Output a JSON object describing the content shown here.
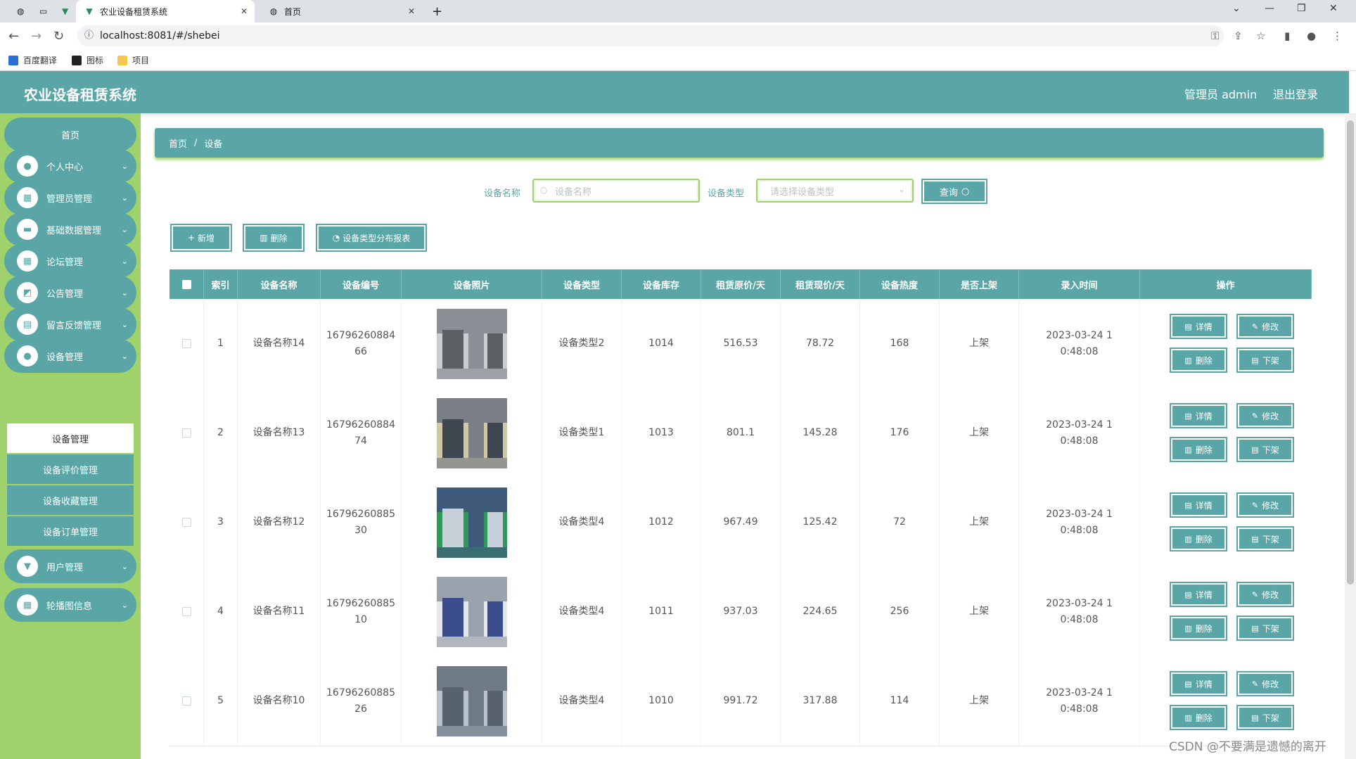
{
  "browser": {
    "tabs": [
      {
        "title": "农业设备租赁系统",
        "active": true
      },
      {
        "title": "首页",
        "active": false
      }
    ],
    "url": "localhost:8081/#/shebei",
    "bookmarks": [
      "百度翻译",
      "图标",
      "项目"
    ]
  },
  "header": {
    "title": "农业设备租赁系统",
    "user": "管理员 admin",
    "logout": "退出登录"
  },
  "sidebar": {
    "home": "首页",
    "items": [
      {
        "label": "个人中心",
        "icon": "user-icon"
      },
      {
        "label": "管理员管理",
        "icon": "grid-icon"
      },
      {
        "label": "基础数据管理",
        "icon": "monitor-icon"
      },
      {
        "label": "论坛管理",
        "icon": "grid-icon"
      },
      {
        "label": "公告管理",
        "icon": "chart-icon"
      },
      {
        "label": "留言反馈管理",
        "icon": "briefcase-icon"
      },
      {
        "label": "设备管理",
        "icon": "user-icon"
      }
    ],
    "submenu": [
      {
        "label": "设备管理",
        "active": true
      },
      {
        "label": "设备评价管理",
        "active": false
      },
      {
        "label": "设备收藏管理",
        "active": false
      },
      {
        "label": "设备订单管理",
        "active": false
      }
    ],
    "items_after": [
      {
        "label": "用户管理",
        "icon": "pin-icon"
      },
      {
        "label": "轮播图信息",
        "icon": "grid-icon"
      }
    ]
  },
  "breadcrumb": {
    "home": "首页",
    "sep": "/",
    "current": "设备"
  },
  "search": {
    "name_label": "设备名称",
    "name_placeholder": "设备名称",
    "type_label": "设备类型",
    "type_placeholder": "请选择设备类型",
    "query_button": "查询"
  },
  "actions": {
    "add": "新增",
    "delete": "删除",
    "report": "设备类型分布报表"
  },
  "table": {
    "columns": [
      "索引",
      "设备名称",
      "设备编号",
      "设备照片",
      "设备类型",
      "设备库存",
      "租赁原价/天",
      "租赁现价/天",
      "设备热度",
      "是否上架",
      "录入时间",
      "操作"
    ],
    "rows": [
      {
        "index": "1",
        "name": "设备名称14",
        "code1": "16796260884",
        "code2": "66",
        "type": "设备类型2",
        "stock": "1014",
        "orig_price": "516.53",
        "cur_price": "78.72",
        "heat": "168",
        "shelf": "上架",
        "time1": "2023-03-24 1",
        "time2": "0:48:08"
      },
      {
        "index": "2",
        "name": "设备名称13",
        "code1": "16796260884",
        "code2": "74",
        "type": "设备类型1",
        "stock": "1013",
        "orig_price": "801.1",
        "cur_price": "145.28",
        "heat": "176",
        "shelf": "上架",
        "time1": "2023-03-24 1",
        "time2": "0:48:08"
      },
      {
        "index": "3",
        "name": "设备名称12",
        "code1": "16796260885",
        "code2": "30",
        "type": "设备类型4",
        "stock": "1012",
        "orig_price": "967.49",
        "cur_price": "125.42",
        "heat": "72",
        "shelf": "上架",
        "time1": "2023-03-24 1",
        "time2": "0:48:08"
      },
      {
        "index": "4",
        "name": "设备名称11",
        "code1": "16796260885",
        "code2": "10",
        "type": "设备类型4",
        "stock": "1011",
        "orig_price": "937.03",
        "cur_price": "224.65",
        "heat": "256",
        "shelf": "上架",
        "time1": "2023-03-24 1",
        "time2": "0:48:08"
      },
      {
        "index": "5",
        "name": "设备名称10",
        "code1": "16796260885",
        "code2": "26",
        "type": "设备类型4",
        "stock": "1010",
        "orig_price": "991.72",
        "cur_price": "317.88",
        "heat": "114",
        "shelf": "上架",
        "time1": "2023-03-24 1",
        "time2": "0:48:08"
      }
    ],
    "row_buttons": {
      "detail": "详情",
      "edit": "修改",
      "delete": "删除",
      "unshelf": "下架"
    }
  },
  "watermark": "CSDN @不要满是遗憾的离开",
  "colors": {
    "primary": "#5aa6a6",
    "sidebar": "#9fd26a"
  }
}
